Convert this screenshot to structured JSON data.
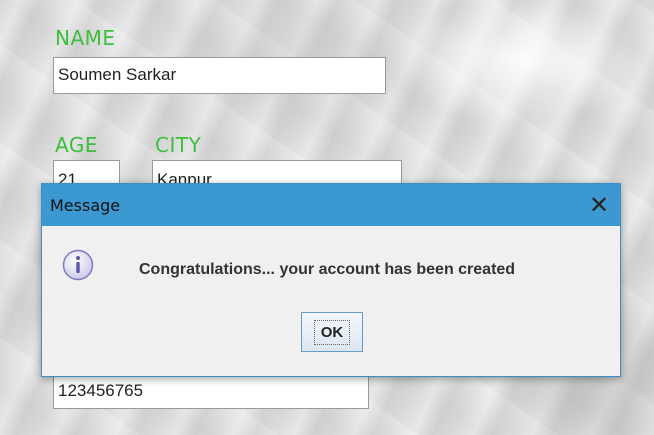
{
  "form": {
    "name_label": "NAME",
    "name_value": "Soumen Sarkar",
    "age_label": "AGE",
    "age_value": "21",
    "city_label": "CITY",
    "city_value": "Kanpur",
    "phone_value": "123456765"
  },
  "dialog": {
    "title": "Message",
    "close_glyph": "✕",
    "message": "Congratulations... your account has been created",
    "ok_label": "OK"
  },
  "colors": {
    "label_green": "#3cbf3c",
    "titlebar_blue": "#3c98d0"
  }
}
